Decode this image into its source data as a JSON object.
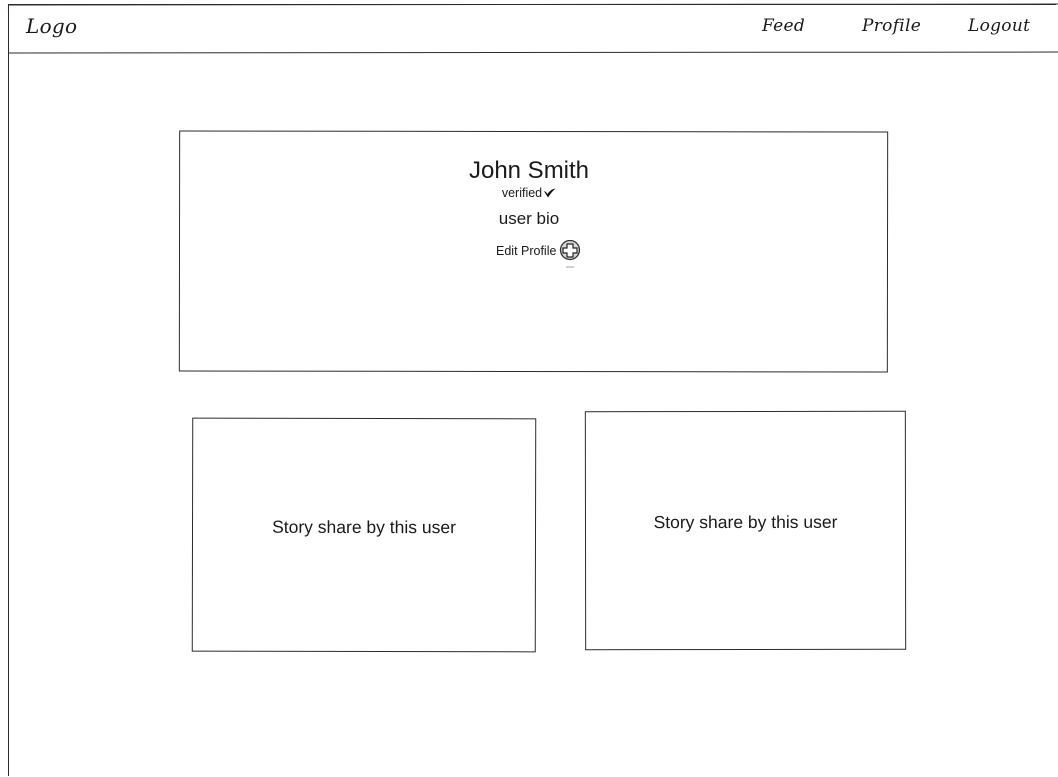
{
  "header": {
    "logo": "Logo",
    "nav": {
      "feed": "Feed",
      "profile": "Profile",
      "logout": "Logout"
    }
  },
  "profile": {
    "name": "John Smith",
    "verified_label": "verified",
    "verified_icon": "checkmark-icon",
    "bio": "user bio",
    "edit_label": "Edit Profile",
    "edit_icon": "plus-circle-icon"
  },
  "stories": [
    {
      "label": "Story share by this user"
    },
    {
      "label": "Story share by this user"
    }
  ]
}
